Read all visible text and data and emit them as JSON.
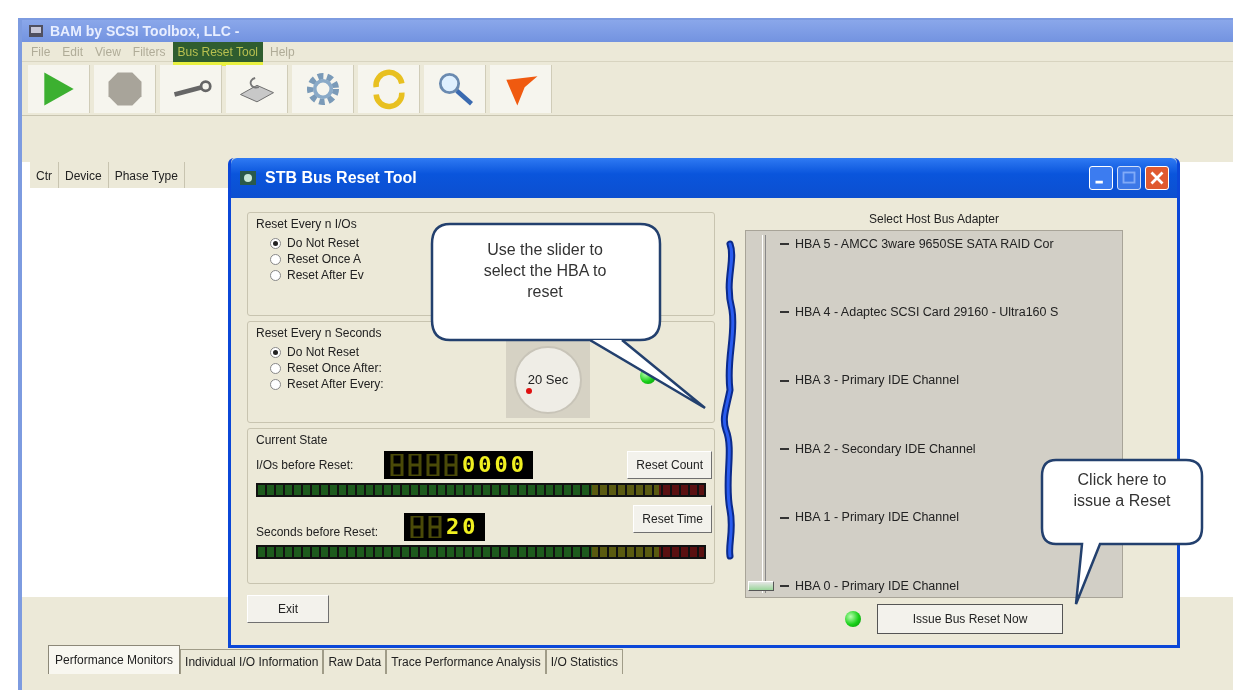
{
  "main_window": {
    "title": "BAM by SCSI Toolbox, LLC -",
    "menu": [
      {
        "label": "File",
        "selected": false
      },
      {
        "label": "Edit",
        "selected": false
      },
      {
        "label": "View",
        "selected": false
      },
      {
        "label": "Filters",
        "selected": false
      },
      {
        "label": "Bus Reset Tool",
        "selected": true
      },
      {
        "label": "Help",
        "selected": false
      }
    ],
    "columns": [
      "Ctr",
      "Device",
      "Phase Type"
    ],
    "tabs": [
      {
        "label": "Performance Monitors",
        "selected": true
      },
      {
        "label": "Individual I/O Information",
        "selected": false
      },
      {
        "label": "Raw Data",
        "selected": false
      },
      {
        "label": "Trace Performance Analysis",
        "selected": false
      },
      {
        "label": "I/O Statistics",
        "selected": false
      }
    ]
  },
  "dialog": {
    "title": "STB Bus Reset Tool",
    "io_group": {
      "title": "Reset Every n I/Os",
      "options": [
        {
          "label": "Do Not Reset",
          "selected": true
        },
        {
          "label": "Reset Once A",
          "selected": false
        },
        {
          "label": "Reset After Ev",
          "selected": false
        }
      ]
    },
    "seconds_group": {
      "title": "Reset Every n Seconds",
      "options": [
        {
          "label": "Do Not Reset",
          "selected": true
        },
        {
          "label": "Reset Once After:",
          "selected": false
        },
        {
          "label": "Reset After Every:",
          "selected": false
        }
      ],
      "dial": "20 Sec"
    },
    "current_state": {
      "title": "Current State",
      "io_label": "I/Os before Reset:",
      "io_count": "0000",
      "io_button": "Reset Count",
      "seconds_label": "Seconds before Reset:",
      "seconds_count": "20",
      "seconds_button": "Reset Time"
    },
    "exit_button": "Exit",
    "hba": {
      "title": "Select Host Bus Adapter",
      "items": [
        {
          "label": "HBA 5 - AMCC 3ware 9650SE SATA RAID Cor",
          "selected": false
        },
        {
          "label": "HBA 4 - Adaptec SCSI Card 29160 - Ultra160 S",
          "selected": false
        },
        {
          "label": "HBA 3 - Primary IDE Channel",
          "selected": false
        },
        {
          "label": "HBA 2 - Secondary IDE Channel",
          "selected": false
        },
        {
          "label": "HBA 1 - Primary IDE Channel",
          "selected": false
        },
        {
          "label": "HBA 0 - Primary IDE Channel",
          "selected": true
        }
      ]
    },
    "reset_button": "Issue Bus Reset Now"
  },
  "callouts": [
    {
      "text": "Use the slider to select the HBA to reset"
    },
    {
      "text": "Click here to issue a Reset"
    }
  ]
}
